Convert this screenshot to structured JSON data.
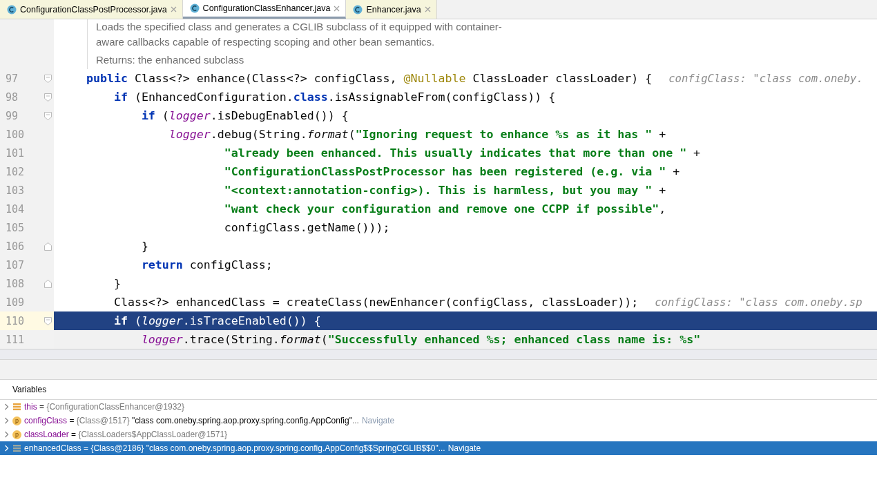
{
  "tabs": [
    {
      "label": "ConfigurationClassPostProcessor.java",
      "selected": false
    },
    {
      "label": "ConfigurationClassEnhancer.java",
      "selected": true
    },
    {
      "label": "Enhancer.java",
      "selected": false
    }
  ],
  "doc": {
    "lines": [
      "Loads the specified class and generates a CGLIB subclass of it equipped with container-",
      "aware callbacks capable of respecting scoping and other bean semantics."
    ],
    "returns": "Returns: the enhanced subclass"
  },
  "code": [
    {
      "number": "97",
      "kind": "fold-start",
      "selected": false,
      "tokens": [
        {
          "kind": "keyword",
          "text": "    public"
        },
        {
          "kind": "plain",
          "text": " Class<?> enhance(Class<?> configClass, "
        },
        {
          "kind": "annotation",
          "text": "@Nullable"
        },
        {
          "kind": "plain",
          "text": " ClassLoader classLoader) {"
        }
      ],
      "hint": "configClass: \"class com.oneby."
    },
    {
      "number": "98",
      "kind": "fold-start",
      "selected": false,
      "tokens": [
        {
          "kind": "keyword",
          "text": "        if"
        },
        {
          "kind": "plain",
          "text": " (EnhancedConfiguration."
        },
        {
          "kind": "keyword",
          "text": "class"
        },
        {
          "kind": "plain",
          "text": ".isAssignableFrom(configClass)) {"
        }
      ]
    },
    {
      "number": "99",
      "kind": "fold-start",
      "selected": false,
      "tokens": [
        {
          "kind": "keyword",
          "text": "            if"
        },
        {
          "kind": "plain",
          "text": " ("
        },
        {
          "kind": "field",
          "text": "logger"
        },
        {
          "kind": "plain",
          "text": ".isDebugEnabled()) {"
        }
      ]
    },
    {
      "number": "100",
      "kind": "plain",
      "selected": false,
      "tokens": [
        {
          "kind": "field",
          "text": "                logger"
        },
        {
          "kind": "plain",
          "text": ".debug(String."
        },
        {
          "kind": "static",
          "text": "format"
        },
        {
          "kind": "plain",
          "text": "("
        },
        {
          "kind": "string",
          "text": "\"Ignoring request to enhance %s as it has \""
        },
        {
          "kind": "plain",
          "text": " +"
        }
      ]
    },
    {
      "number": "101",
      "kind": "plain",
      "selected": false,
      "tokens": [
        {
          "kind": "string",
          "text": "                        \"already been enhanced. This usually indicates that more than one \""
        },
        {
          "kind": "plain",
          "text": " +"
        }
      ]
    },
    {
      "number": "102",
      "kind": "plain",
      "selected": false,
      "tokens": [
        {
          "kind": "string",
          "text": "                        \"ConfigurationClassPostProcessor has been registered (e.g. via \""
        },
        {
          "kind": "plain",
          "text": " +"
        }
      ]
    },
    {
      "number": "103",
      "kind": "plain",
      "selected": false,
      "tokens": [
        {
          "kind": "string",
          "text": "                        \"<context:annotation-config>). This is harmless, but you may \""
        },
        {
          "kind": "plain",
          "text": " +"
        }
      ]
    },
    {
      "number": "104",
      "kind": "plain",
      "selected": false,
      "tokens": [
        {
          "kind": "string",
          "text": "                        \"want check your configuration and remove one CCPP if possible\""
        },
        {
          "kind": "plain",
          "text": ","
        }
      ]
    },
    {
      "number": "105",
      "kind": "plain",
      "selected": false,
      "tokens": [
        {
          "kind": "plain",
          "text": "                        configClass.getName()));"
        }
      ]
    },
    {
      "number": "106",
      "kind": "fold-end",
      "selected": false,
      "tokens": [
        {
          "kind": "plain",
          "text": "            }"
        }
      ]
    },
    {
      "number": "107",
      "kind": "plain",
      "selected": false,
      "tokens": [
        {
          "kind": "keyword",
          "text": "            return"
        },
        {
          "kind": "plain",
          "text": " configClass;"
        }
      ]
    },
    {
      "number": "108",
      "kind": "fold-end",
      "selected": false,
      "tokens": [
        {
          "kind": "plain",
          "text": "        }"
        }
      ]
    },
    {
      "number": "109",
      "kind": "plain",
      "selected": false,
      "tokens": [
        {
          "kind": "plain",
          "text": "        Class<?> enhancedClass = createClass(newEnhancer(configClass, classLoader));"
        }
      ],
      "hint": "configClass: \"class com.oneby.sp"
    },
    {
      "number": "110",
      "kind": "fold-start",
      "selected": true,
      "tokens": [
        {
          "kind": "keyword",
          "text": "        if"
        },
        {
          "kind": "plain",
          "text": " ("
        },
        {
          "kind": "field",
          "text": "logger"
        },
        {
          "kind": "plain",
          "text": ".isTraceEnabled()) {"
        }
      ]
    },
    {
      "number": "111",
      "kind": "plain",
      "selected": false,
      "tokens": [
        {
          "kind": "field",
          "text": "            logger"
        },
        {
          "kind": "plain",
          "text": ".trace(String."
        },
        {
          "kind": "static",
          "text": "format"
        },
        {
          "kind": "plain",
          "text": "("
        },
        {
          "kind": "string",
          "text": "\"Successfully enhanced %s; enhanced class name is: %s\""
        }
      ]
    }
  ],
  "variables": {
    "title": "Variables",
    "rows": [
      {
        "kind": "field",
        "name": "this",
        "sep": "=",
        "type": "{ConfigurationClassEnhancer@1932}",
        "selected": false
      },
      {
        "kind": "param",
        "badge": "p",
        "name": "configClass",
        "sep": "=",
        "type": "{Class@1517}",
        "value": "\"class com.oneby.spring.aop.proxy.spring.config.AppConfig\"",
        "more": "...",
        "link": "Navigate",
        "selected": false
      },
      {
        "kind": "param",
        "badge": "p",
        "name": "classLoader",
        "sep": "=",
        "type": "{ClassLoaders$AppClassLoader@1571}",
        "selected": false
      },
      {
        "kind": "local",
        "name": "enhancedClass",
        "sep": "=",
        "type": "{Class@2186}",
        "value": "\"class com.oneby.spring.aop.proxy.spring.config.AppConfig$$SpringCGLIB$$0\"",
        "more": "...",
        "link": "Navigate",
        "selected": true
      }
    ]
  }
}
